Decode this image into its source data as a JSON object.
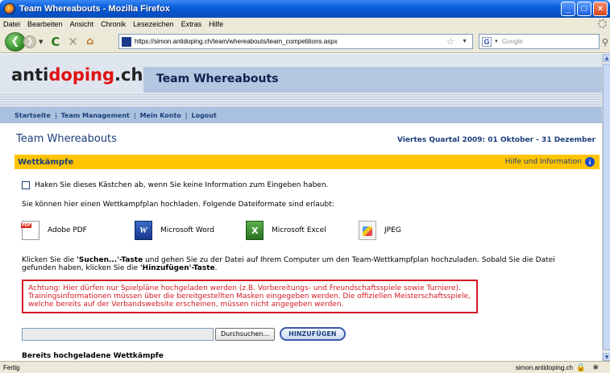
{
  "window": {
    "title": "Team Whereabouts - Mozilla Firefox",
    "controls": [
      "_",
      "□",
      "×"
    ]
  },
  "menu": [
    "Datei",
    "Bearbeiten",
    "Ansicht",
    "Chronik",
    "Lesezeichen",
    "Extras",
    "Hilfe"
  ],
  "nav": {
    "url": "https://simon.antidoping.ch/team/whereabouts/team_competitions.aspx",
    "search_placeholder": "Google",
    "search_engine_letter": "G"
  },
  "site": {
    "logo_black": "anti",
    "logo_red": "doping",
    "logo_suffix": ".ch",
    "header_title": "Team Whereabouts",
    "nav_links": [
      "Startseite",
      "Team Management",
      "Mein Konto",
      "Logout"
    ],
    "section_title": "Team Whereabouts",
    "quarter": "Viertes Quartal 2009: 01 Oktober - 31 Dezember",
    "bar_title": "Wettkämpfe",
    "help_label": "Hilfe und Information",
    "checkbox_label": "Haken Sie dieses Kästchen ab, wenn Sie keine Information zum Eingeben haben.",
    "upload_intro": "Sie können hier einen Wettkampfplan hochladen. Folgende Dateiformate sind erlaubt:",
    "formats": [
      "Adobe PDF",
      "Microsoft Word",
      "Microsoft Excel",
      "JPEG"
    ],
    "instr_part1": "Klicken Sie die ",
    "instr_bold1": "'Suchen...'-Taste",
    "instr_part2": " und gehen Sie zu der Datei auf Ihrem Computer um den Team-Wettkampfplan hochzuladen. Sobald Sie die Datei gefunden haben, klicken Sie die ",
    "instr_bold2": "'Hinzufügen'-Taste",
    "instr_part3": ".",
    "warning": "Achtung: Hier dürfen nur Spielpläne hochgeladen werden (z.B. Vorbereitungs- und Freundschaftsspiele sowie Turniere). Trainingsinformationen müssen über die bereitgestellten Masken eingegeben werden. Die offiziellen Meisterschaftsspiele, welche bereits auf der Verbandswebsite erscheinen, müssen nicht angegeben werden.",
    "browse_label": "Durchsuchen...",
    "add_label": "HINZUFÜGEN",
    "uploaded_title": "Bereits hochgeladene Wettkämpfe"
  },
  "status": {
    "text": "Fertig",
    "host": "simon.antidoping.ch"
  },
  "colors": {
    "accent_yellow": "#ffc400",
    "nav_blue": "#1d3f7c",
    "warning_red": "#d31a25",
    "logo_red": "#e01010"
  }
}
